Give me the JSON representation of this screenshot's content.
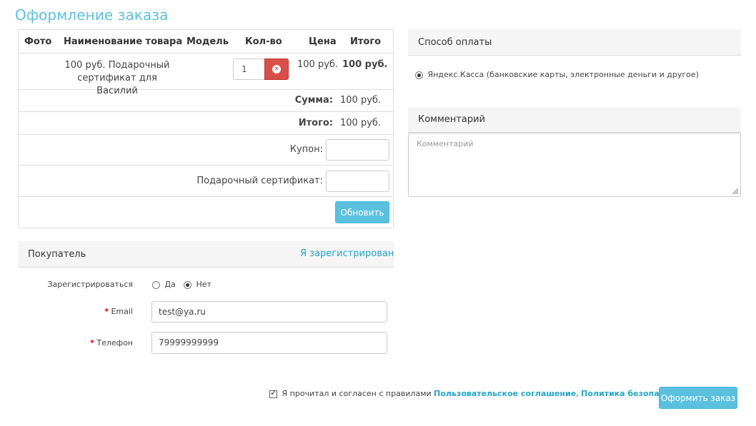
{
  "page": {
    "title": "Оформление заказа"
  },
  "cart": {
    "headers": {
      "photo": "Фото",
      "name": "Наименование товара",
      "model": "Модель",
      "qty": "Кол-во",
      "price": "Цена",
      "total": "Итого"
    },
    "item": {
      "name_line1": "100 руб. Подарочный",
      "name_line2": "сертификат для Василий",
      "model": "",
      "qty": "1",
      "price": "100 руб.",
      "total": "100 руб."
    },
    "subtotal": {
      "label": "Сумма:",
      "value": "100 руб."
    },
    "grand_total": {
      "label": "Итого:",
      "value": "100 руб."
    },
    "coupon": {
      "label": "Купон:",
      "value": ""
    },
    "voucher": {
      "label": "Подарочный сертификат:",
      "value": ""
    },
    "update_label": "Обновить"
  },
  "customer": {
    "title": "Покупатель",
    "login_link": "Я зарегистрирован",
    "register": {
      "label": "Зарегистрироваться",
      "yes": "Да",
      "no": "Нет",
      "selected": "no"
    },
    "email": {
      "label": "Email",
      "value": "test@ya.ru"
    },
    "phone": {
      "label": "Телефон",
      "value": "79999999999"
    },
    "required_mark": "*"
  },
  "payment": {
    "title": "Способ оплаты",
    "option": "Яндекс.Касса (банковские карты, электронные деньги и другое)"
  },
  "comment": {
    "title": "Комментарий",
    "placeholder": "Комментарий"
  },
  "agreement": {
    "text": "Я прочитал и согласен с правилами",
    "link1": "Пользовательское соглашение",
    "separator": ",",
    "link2": "Политика безопасности",
    "checked": true
  },
  "submit_label": "Оформить заказ",
  "colors": {
    "accent": "#5bc0de",
    "link": "#23a6c7",
    "danger": "#da4f49",
    "required": "#cc0000"
  }
}
